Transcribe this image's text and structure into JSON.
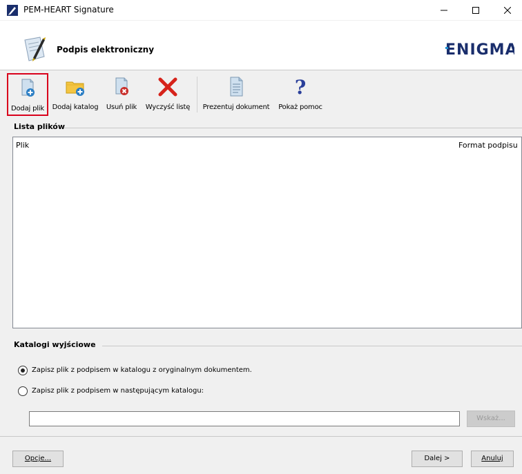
{
  "window": {
    "title": "PEM-HEART Signature",
    "controls": {
      "minimize": "minimize-icon",
      "maximize": "maximize-icon",
      "close": "close-icon"
    }
  },
  "header": {
    "title": "Podpis elektroniczny",
    "logo_text": "ENIGMA",
    "brand_color": "#1a2e6c",
    "accent_color": "#1e8fcf"
  },
  "toolbar": {
    "items": [
      {
        "label": "Dodaj plik",
        "icon": "add-file-icon",
        "active": true
      },
      {
        "label": "Dodaj katalog",
        "icon": "add-folder-icon"
      },
      {
        "label": "Usuń plik",
        "icon": "remove-file-icon"
      },
      {
        "label": "Wyczyść listę",
        "icon": "clear-list-icon"
      },
      {
        "label": "Prezentuj dokument",
        "icon": "document-icon"
      },
      {
        "label": "Pokaż pomoc",
        "icon": "help-icon"
      }
    ],
    "active_border_color": "#d9001b"
  },
  "files": {
    "group_title": "Lista plików",
    "columns": [
      "Plik",
      "Format podpisu"
    ],
    "rows": []
  },
  "output": {
    "group_title": "Katalogi wyjściowe",
    "option_original": "Zapisz plik z podpisem w katalogu z oryginalnym dokumentem.",
    "option_custom": "Zapisz plik z podpisem w następującym katalogu:",
    "selected": "original",
    "path_value": "",
    "browse_label": "Wskaż..."
  },
  "footer": {
    "options_label": "Opcje...",
    "next_label": "Dalej >",
    "cancel_label": "Anuluj"
  }
}
